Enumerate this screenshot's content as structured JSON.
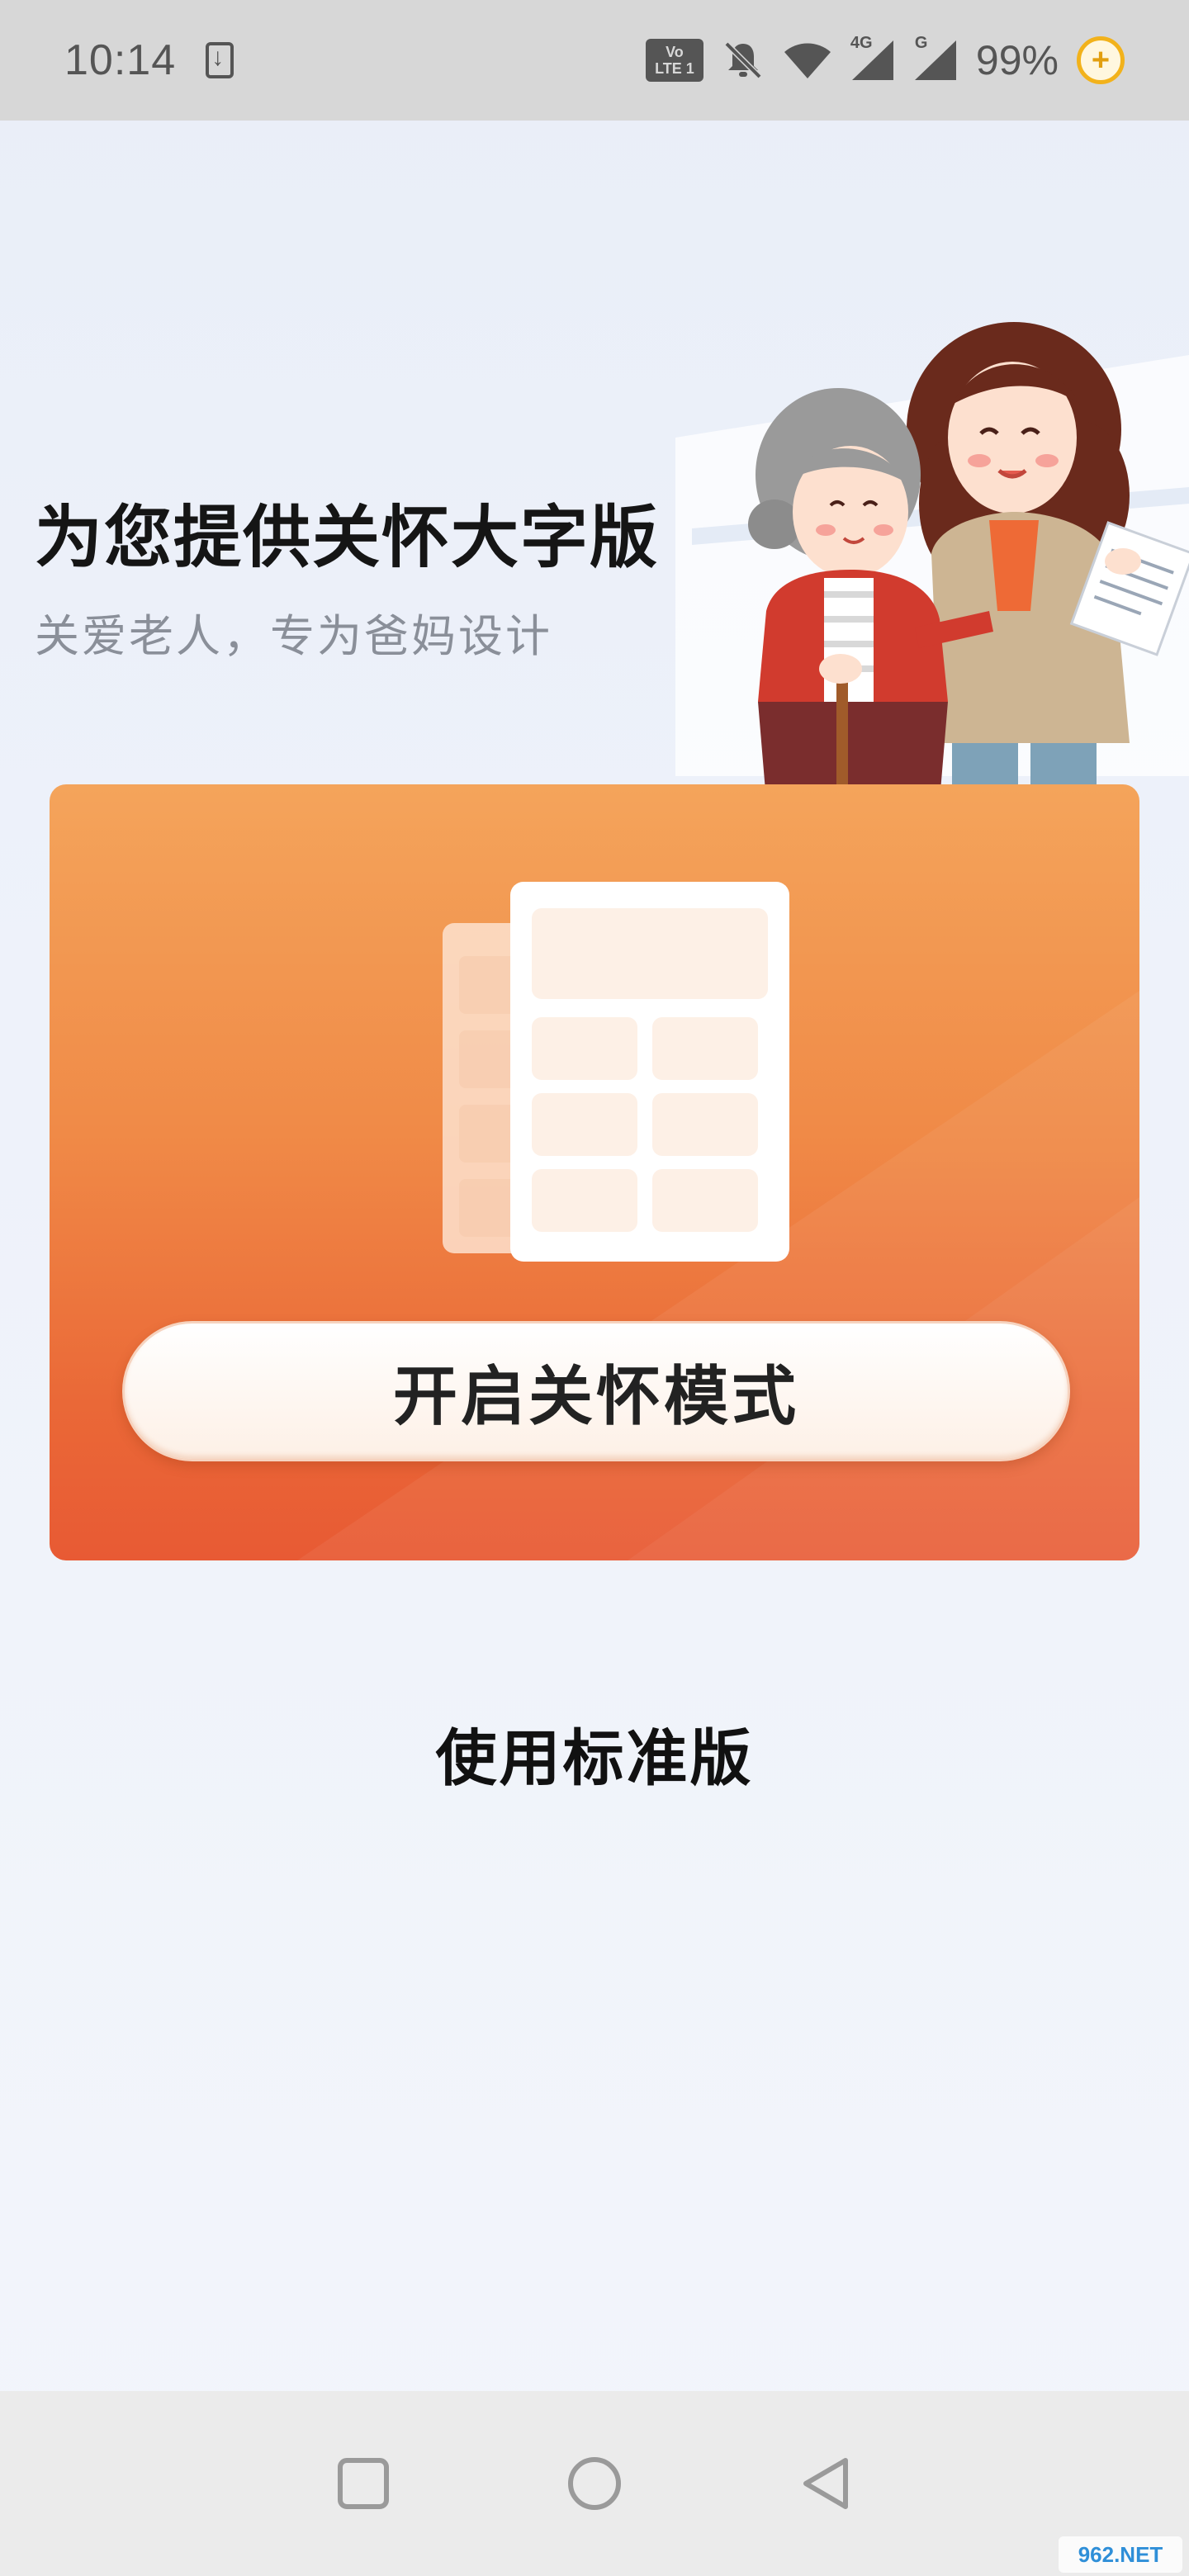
{
  "status_bar": {
    "time": "10:14",
    "battery": "99%",
    "volte_line1": "Vo",
    "volte_line2": "LTE 1",
    "signal_1_label": "4G",
    "signal_2_label": "G"
  },
  "header": {
    "title": "为您提供关怀大字版",
    "subtitle": "关爱老人，专为爸妈设计"
  },
  "card": {
    "button_label": "开启关怀模式"
  },
  "standard_link": "使用标准版",
  "watermark": "962.NET",
  "colors": {
    "card_top": "#f4a45b",
    "card_bottom": "#e85a34",
    "background": "#eef2fa",
    "battery_accent": "#f2b21b"
  },
  "icons": {
    "download": "download-notification-icon",
    "volte": "volte-icon",
    "bell_off": "bell-off-icon",
    "wifi": "wifi-icon",
    "signal": "signal-icon",
    "battery": "battery-saver-icon",
    "nav_recent": "square-icon",
    "nav_home": "circle-icon",
    "nav_back": "triangle-back-icon"
  }
}
